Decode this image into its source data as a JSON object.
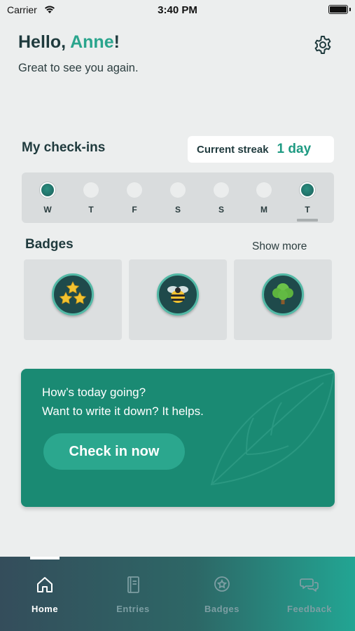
{
  "status_bar": {
    "carrier": "Carrier",
    "time": "3:40 PM"
  },
  "header": {
    "hello": "Hello, ",
    "name": "Anne",
    "exclaim": "!",
    "subtitle": "Great to see you again.",
    "settings_icon": "gear-icon"
  },
  "checkins": {
    "title": "My check-ins",
    "streak_label": "Current streak",
    "streak_value": "1 day",
    "days": [
      {
        "letter": "W",
        "done": true
      },
      {
        "letter": "T",
        "done": false
      },
      {
        "letter": "F",
        "done": false
      },
      {
        "letter": "S",
        "done": false
      },
      {
        "letter": "S",
        "done": false
      },
      {
        "letter": "M",
        "done": false
      },
      {
        "letter": "T",
        "done": true,
        "today": true
      }
    ]
  },
  "badges": {
    "title": "Badges",
    "show_more": "Show more",
    "items": [
      {
        "icon": "three-stars-icon"
      },
      {
        "icon": "bee-icon"
      },
      {
        "icon": "tree-icon"
      }
    ]
  },
  "prompt_card": {
    "line1": "How’s today going?",
    "line2": "Want to write it down? It helps.",
    "button": "Check in now"
  },
  "tabbar": {
    "tabs": [
      {
        "label": "Home",
        "icon": "home-icon",
        "active": true
      },
      {
        "label": "Entries",
        "icon": "notebook-icon",
        "active": false
      },
      {
        "label": "Badges",
        "icon": "badge-icon",
        "active": false
      },
      {
        "label": "Feedback",
        "icon": "chat-bubbles-icon",
        "active": false
      }
    ]
  },
  "colors": {
    "accent": "#2aa58d",
    "card": "#1a8a73",
    "button": "#2ba78e",
    "text_dark": "#1f3a3d"
  }
}
